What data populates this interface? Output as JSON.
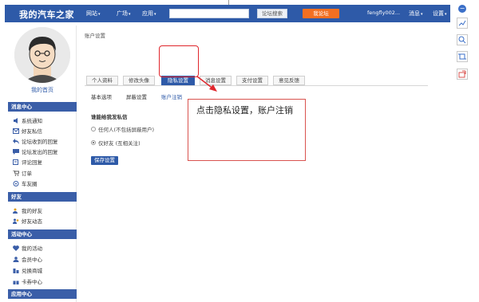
{
  "site": {
    "logo": "我的汽车之家"
  },
  "nav": {
    "items": [
      "网站",
      "广场",
      "应用"
    ]
  },
  "search": {
    "placeholder": "",
    "button": "论坛搜索"
  },
  "header": {
    "ask_button": "我论坛",
    "user": "fengfly002...",
    "messages": "消息",
    "settings": "设置"
  },
  "sidebar": {
    "home_link": "我的首页",
    "sections": [
      {
        "title": "消息中心",
        "items": [
          "系统通知",
          "好友私信",
          "论坛收到的回复",
          "论坛发出的回复",
          "评论回复"
        ]
      },
      {
        "title": "",
        "items": [
          "订单",
          "车友圈"
        ]
      },
      {
        "title": "好友",
        "items": [
          "我的好友",
          "好友动态"
        ]
      },
      {
        "title": "活动中心",
        "items": [
          "我的活动",
          "会员中心",
          "兑换商城",
          "卡券中心"
        ]
      },
      {
        "title": "应用中心",
        "items": []
      }
    ]
  },
  "content": {
    "breadcrumb": "账户设置",
    "tabs": [
      "个人资料",
      "修改头像",
      "隐私设置",
      "消息设置",
      "支付设置",
      "意见反馈"
    ],
    "active_tab": "隐私设置",
    "subtabs": [
      "基本选项",
      "屏蔽设置",
      "账户注销"
    ],
    "section_title": "谁能给我发私信",
    "options": [
      "任何人(不包括屏蔽用户)",
      "仅好友 (互相关注)"
    ],
    "selected_option": "仅好友 (互相关注)",
    "save_button": "保存设置"
  },
  "annotation": {
    "callout_text": "点击隐私设置，账户注销"
  },
  "colors": {
    "brand": "#2e5aa8",
    "accent": "#f36f21",
    "annotation": "#e0262c"
  },
  "icons": {
    "right_toolbar": [
      "collapse-icon",
      "trend-icon",
      "zoom-icon",
      "crop-icon",
      "export-icon"
    ]
  }
}
